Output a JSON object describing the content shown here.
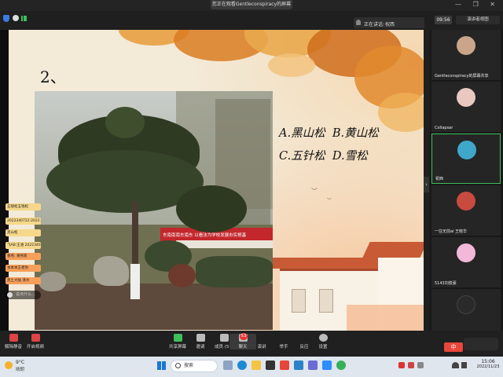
{
  "window": {
    "share_banner": "您正在观看Gentleconspiracy的屏幕",
    "controls": "— ❐ ✕"
  },
  "toolbar": {
    "speaking_label": "正在讲话:",
    "speaking_name": "祝西",
    "timer": "09:56",
    "view_mode": "演讲者视图"
  },
  "slide": {
    "number": "2、",
    "options": [
      {
        "letter": "A.",
        "text": "黑山松",
        "letter2": "B.",
        "text2": "黄山松"
      },
      {
        "letter": "C.",
        "text": "五针松",
        "letter2": "D.",
        "text2": "雪松"
      }
    ]
  },
  "photo": {
    "banner_text": "东南南南东南东 以看法为学校发展夯实根基"
  },
  "chat": {
    "messages": [
      {
        "text": "五钱松五钱松",
        "color": "#f6d88a"
      },
      {
        "text": "2022340722:2022..",
        "color": "#f6d88a"
      },
      {
        "text": "黑山松",
        "color": "#f6d88a"
      },
      {
        "text": "飞AB:王涵 2022340712",
        "color": "#f6d88a"
      },
      {
        "text": "春燕: 黄熙家",
        "color": "#f7a05a"
      },
      {
        "text": "本本本王者你",
        "color": "#f7a05a"
      },
      {
        "text": "黑土大陆 清水",
        "color": "#f7a05a"
      }
    ],
    "input_hint": "说点什么..."
  },
  "gallery": {
    "participants": [
      {
        "name": "Gentleconspiracy的屏幕共享",
        "color": "#cba58a"
      },
      {
        "name": "Collapsar",
        "color": "#e8c8c0"
      },
      {
        "name": "祝西",
        "color": "#3fa7c9"
      },
      {
        "name": "一往无前ai 王晓华",
        "color": "#c94a3f"
      },
      {
        "name": "5143刘俊豪",
        "color": "#f2b8d8"
      },
      {
        "name": "",
        "color": "#2a2a2a"
      }
    ]
  },
  "zoom_toolbar": {
    "left_buttons": [
      {
        "label": "解除静音",
        "icon": "mic-muted-icon"
      },
      {
        "label": "开启视频",
        "icon": "video-off-icon"
      }
    ],
    "center_buttons": [
      {
        "label": "共享屏幕",
        "icon": "share-screen-icon"
      },
      {
        "label": "邀请",
        "icon": "invite-icon"
      },
      {
        "label": "成员 (51)",
        "icon": "participants-icon"
      },
      {
        "label": "聊天",
        "icon": "chat-icon"
      },
      {
        "label": "演讲",
        "icon": "speak-icon"
      },
      {
        "label": "举手",
        "icon": "raise-hand-icon"
      },
      {
        "label": "反应",
        "icon": "reaction-icon"
      },
      {
        "label": "设置",
        "icon": "settings-icon"
      }
    ],
    "chat_badge": "53"
  },
  "taskbar": {
    "weather_temp": "9°C",
    "weather_desc": "晴朗",
    "search_placeholder": "搜索",
    "time": "15:06",
    "date": "2022/11/23",
    "ime": "中"
  }
}
